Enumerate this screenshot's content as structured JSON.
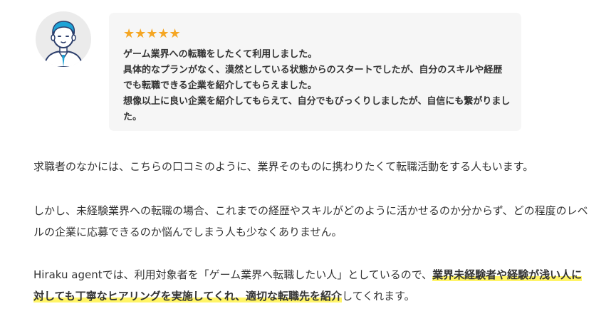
{
  "review": {
    "rating": 5,
    "stars": "★★★★★",
    "avatar_icon": "man-in-suit-avatar-icon",
    "lines": [
      "ゲーム業界への転職をしたくて利用しました。",
      "具体的なプランがなく、漠然としている状態からのスタートでしたが、自分のスキルや経歴でも転職できる企業を紹介してもらえました。",
      "想像以上に良い企業を紹介してもらえて、自分でもびっくりしましたが、自信にも繋がりました。"
    ]
  },
  "article": {
    "p1": "求職者のなかには、こちらの口コミのように、業界そのものに携わりたくて転職活動をする人もいます。",
    "p2": "しかし、未経験業界への転職の場合、これまでの経歴やスキルがどのように活かせるのか分からず、どの程度のレベルの企業に応募できるのか悩んでしまう人も少なくありません。",
    "p3_before": "Hiraku agentでは、利用対象者を「ゲーム業界へ転職したい人」としているので、",
    "p3_highlight": "業界未経験者や経験が浅い人に対しても丁寧なヒアリングを実施してくれ、適切な転職先を紹介",
    "p3_after": "してくれます。"
  },
  "colors": {
    "star": "#f5a623",
    "highlight": "#fff466",
    "bubble_bg": "#f6f6f6",
    "text": "#333333"
  }
}
